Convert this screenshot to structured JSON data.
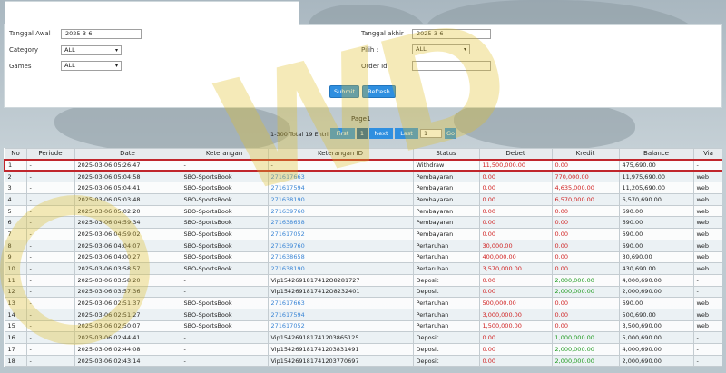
{
  "filters": {
    "tanggal_awal_label": "Tanggal Awal",
    "tanggal_awal_value": "2025-3-6",
    "category_label": "Category",
    "category_value": "ALL",
    "games_label": "Games",
    "games_value": "ALL",
    "tanggal_akhir_label": "Tanggal akhir",
    "tanggal_akhir_value": "2025-3-6",
    "pilih_label": "Pilih :",
    "pilih_value": "ALL",
    "order_id_label": "Order Id",
    "order_id_value": "",
    "submit_label": "Submit",
    "refresh_label": "Refresh"
  },
  "pager": {
    "page_label": "Page1",
    "total_label": "1-300 Total 19 Entri",
    "first_label": "First",
    "current_label": "1",
    "next_label": "Next",
    "last_label": "Last",
    "goto_value": "1",
    "go_label": "Go"
  },
  "table": {
    "headers": [
      "No",
      "Periode",
      "Date",
      "Keterangan",
      "Keterangan ID",
      "Status",
      "Debet",
      "Kredit",
      "Balance",
      "Via"
    ],
    "rows": [
      [
        "1",
        "-",
        "2025-03-06 05:26:47",
        "-",
        "-",
        "Withdraw",
        "11,500,000.00",
        "0.00",
        "475,690.00",
        "-"
      ],
      [
        "2",
        "-",
        "2025-03-06 05:04:58",
        "SBO-SportsBook",
        "271617663",
        "Pembayaran",
        "0.00",
        "770,000.00",
        "11,975,690.00",
        "web"
      ],
      [
        "3",
        "-",
        "2025-03-06 05:04:41",
        "SBO-SportsBook",
        "271617594",
        "Pembayaran",
        "0.00",
        "4,635,000.00",
        "11,205,690.00",
        "web"
      ],
      [
        "4",
        "-",
        "2025-03-06 05:03:48",
        "SBO-SportsBook",
        "271638190",
        "Pembayaran",
        "0.00",
        "6,570,000.00",
        "6,570,690.00",
        "web"
      ],
      [
        "5",
        "-",
        "2025-03-06 05:02:20",
        "SBO-SportsBook",
        "271639760",
        "Pembayaran",
        "0.00",
        "0.00",
        "690.00",
        "web"
      ],
      [
        "6",
        "-",
        "2025-03-06 04:59:34",
        "SBO-SportsBook",
        "271638658",
        "Pembayaran",
        "0.00",
        "0.00",
        "690.00",
        "web"
      ],
      [
        "7",
        "-",
        "2025-03-06 04:59:02",
        "SBO-SportsBook",
        "271617052",
        "Pembayaran",
        "0.00",
        "0.00",
        "690.00",
        "web"
      ],
      [
        "8",
        "-",
        "2025-03-06 04:04:07",
        "SBO-SportsBook",
        "271639760",
        "Pertaruhan",
        "30,000.00",
        "0.00",
        "690.00",
        "web"
      ],
      [
        "9",
        "-",
        "2025-03-06 04:00:27",
        "SBO-SportsBook",
        "271638658",
        "Pertaruhan",
        "400,000.00",
        "0.00",
        "30,690.00",
        "web"
      ],
      [
        "10",
        "-",
        "2025-03-06 03:58:57",
        "SBO-SportsBook",
        "271638190",
        "Pertaruhan",
        "3,570,000.00",
        "0.00",
        "430,690.00",
        "web"
      ],
      [
        "11",
        "-",
        "2025-03-06 03:58:20",
        "-",
        "Vip1542691817412O8281727",
        "Deposit",
        "0.00",
        "2,000,000.00",
        "4,000,690.00",
        "-"
      ],
      [
        "12",
        "-",
        "2025-03-06 03:57:36",
        "-",
        "Vip1542691817412O8232401",
        "Deposit",
        "0.00",
        "2,000,000.00",
        "2,000,690.00",
        "-"
      ],
      [
        "13",
        "-",
        "2025-03-06 02:51:37",
        "SBO-SportsBook",
        "271617663",
        "Pertaruhan",
        "500,000.00",
        "0.00",
        "690.00",
        "web"
      ],
      [
        "14",
        "-",
        "2025-03-06 02:51:27",
        "SBO-SportsBook",
        "271617594",
        "Pertaruhan",
        "3,000,000.00",
        "0.00",
        "500,690.00",
        "web"
      ],
      [
        "15",
        "-",
        "2025-03-06 02:50:07",
        "SBO-SportsBook",
        "271617052",
        "Pertaruhan",
        "1,500,000.00",
        "0.00",
        "3,500,690.00",
        "web"
      ],
      [
        "16",
        "-",
        "2025-03-06 02:44:41",
        "-",
        "Vip154269181741203865125",
        "Deposit",
        "0.00",
        "1,000,000.00",
        "5,000,690.00",
        "-"
      ],
      [
        "17",
        "-",
        "2025-03-06 02:44:08",
        "-",
        "Vip154269181741203831491",
        "Deposit",
        "0.00",
        "2,000,000.00",
        "4,000,690.00",
        "-"
      ],
      [
        "18",
        "-",
        "2025-03-06 02:43:14",
        "-",
        "Vip154269181741203770697",
        "Deposit",
        "0.00",
        "2,000,000.00",
        "2,000,690.00",
        "-"
      ]
    ]
  },
  "watermark": "WD",
  "colors": {
    "accent_blue": "#2f8fe0",
    "link_blue": "#3b86d6",
    "highlight_red": "#c0262c",
    "debit_red": "#d02020",
    "credit_green": "#1e9a1e"
  }
}
